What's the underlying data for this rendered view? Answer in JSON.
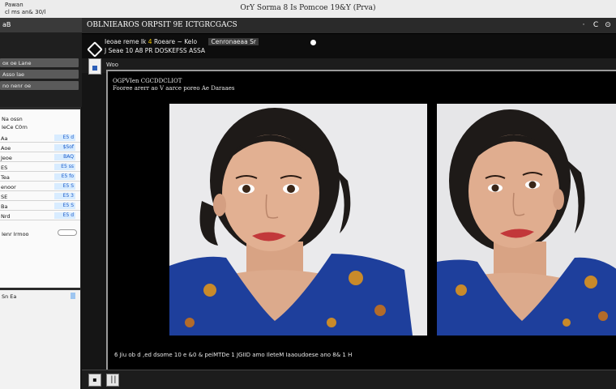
{
  "os": {
    "line1": "Pawan",
    "line2": "cl ms  an& 30/l",
    "title": "OrY Sorma 8 Is Pomcoe 19&Y (Prva)"
  },
  "left_panel": {
    "header": "aB",
    "dark_rows": [
      "ox oe Lane",
      "Asso lae",
      "no nenr oe"
    ],
    "section1": "Na ossn",
    "section2": "IeCe C0rn",
    "items": [
      {
        "name": "Aa",
        "value": "E5 d"
      },
      {
        "name": "Aoe",
        "value": "$Sof"
      },
      {
        "name": "Jeoe",
        "value": "BAQ"
      },
      {
        "name": "ES",
        "value": "E5 ss"
      },
      {
        "name": "Tea",
        "value": "E5 fo"
      },
      {
        "name": "enoor",
        "value": "E5 S"
      },
      {
        "name": "SE",
        "value": "E5 3"
      },
      {
        "name": "Ba",
        "value": "E5 S"
      },
      {
        "name": "Nrd",
        "value": "E5 d"
      }
    ],
    "toggle_label": "Ienr Irmoo",
    "bottom_label": "Sn  Ea"
  },
  "tab": {
    "title": "OBLNIEAROS ORPSIT 9E  ICTGRCGACS",
    "controls": [
      "·",
      "C",
      "⊙"
    ]
  },
  "toolbar": {
    "line1_a": "Ieoae reme Ik",
    "line1_acc": "4",
    "line1_b": "Roeare",
    "line1_c": "~ Kelo",
    "line1_chip": "Cenronaeaa Sr",
    "line2": "J Seae  10  A8  PR  DOSKEFSS ASSA"
  },
  "sub": {
    "label": "Woo"
  },
  "canvas": {
    "header1": "OGPVIen  CGCDDCLIOT",
    "header2": "Fooree arerr ao V aarce poreo Ae Daraaes",
    "footer": "6 Jiu ob d ,ed dsome 10 e &0 & peiMTDe 1 JGIID amo IleteM Iaaoudoese  ano 8& 1 H"
  },
  "status": {
    "btn1": "▪",
    "btn2": "⎥⎥"
  },
  "colors": {
    "accent": "#f2c200",
    "value_blue": "#1a5ac8",
    "dress_blue": "#1e3f9c"
  }
}
